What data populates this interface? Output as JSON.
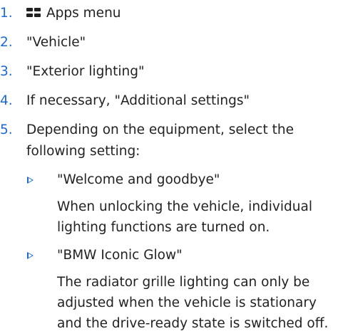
{
  "steps": [
    {
      "num": "1.",
      "text": "Apps menu",
      "icon": "apps-grid-icon"
    },
    {
      "num": "2.",
      "text": "\"Vehicle\""
    },
    {
      "num": "3.",
      "text": "\"Exterior lighting\""
    },
    {
      "num": "4.",
      "text": "If necessary, \"Additional settings\""
    },
    {
      "num": "5.",
      "text": "Depending on the equipment, select the following setting:"
    }
  ],
  "settings": [
    {
      "label": "\"Welcome and goodbye\"",
      "description": "When unlocking the vehicle, individual lighting functions are turned on."
    },
    {
      "label": "\"BMW Iconic Glow\"",
      "description": "The radiator grille lighting can only be adjusted when the vehicle is stationary and the drive-ready state is switched off."
    }
  ],
  "colors": {
    "accent": "#1c69d4",
    "text": "#222222",
    "background": "#ffffff"
  }
}
